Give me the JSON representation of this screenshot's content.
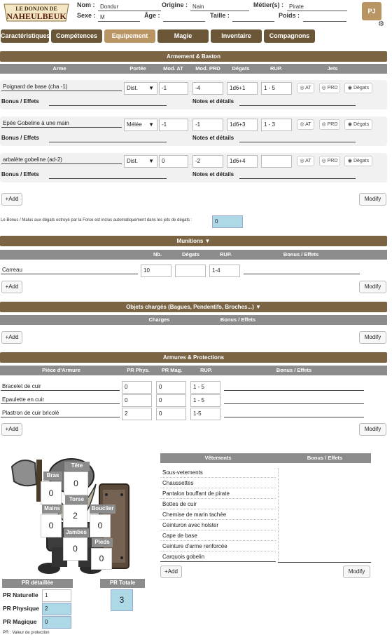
{
  "header": {
    "logo_text": "LE DONJON DE NAHEULBEUK",
    "nom_label": "Nom :",
    "nom": "Dondur",
    "origine_label": "Origine :",
    "origine": "Nain",
    "metier_label": "Métier(s) :",
    "metier": "Pirate",
    "sexe_label": "Sexe :",
    "sexe": "M",
    "age_label": "Âge :",
    "age": "",
    "taille_label": "Taille :",
    "taille": "",
    "poids_label": "Poids :",
    "poids": "",
    "pj_label": "PJ"
  },
  "tabs": [
    "Caractéristiques",
    "Compétences",
    "Equipement",
    "Magie",
    "Inventaire",
    "Compagnons"
  ],
  "armement": {
    "title": "Armement & Baston",
    "columns": [
      "Arme",
      "Portée",
      "Mod. AT",
      "Mod. PRD",
      "Dégats",
      "RUP.",
      "Jets"
    ],
    "bonus_label": "Bonus / Effets",
    "notes_label": "Notes et détails",
    "at_btn": "AT",
    "prd_btn": "PRD",
    "degats_btn": "Dégats",
    "weapons": [
      {
        "name": "Poignard de base (cha -1)",
        "portee": "Dist.",
        "at": "-1",
        "prd": "-4",
        "degats": "1d6+1",
        "rup": "1 - 5"
      },
      {
        "name": "Epée Gobeline à une main",
        "portee": "Mélée",
        "at": "-1",
        "prd": "-1",
        "degats": "1d6+3",
        "rup": "1 - 3"
      },
      {
        "name": "arbalète gobeline (ad-2)",
        "portee": "Dist.",
        "at": "0",
        "prd": "-2",
        "degats": "1d6+4",
        "rup": ""
      }
    ],
    "add": "+Add",
    "modify": "Modify",
    "force_note": "Le Bonus / Malus aux dégats octroyé par la Force est inclus automatiquement dans les jets de dégats :",
    "force_value": "0"
  },
  "munitions": {
    "title": "Munitions ▼",
    "columns": [
      "Nb.",
      "Dégats",
      "RUP.",
      "Bonus / Effets"
    ],
    "items": [
      {
        "name": "Carreau",
        "nb": "10",
        "degats": "",
        "rup": "1-4",
        "bonus": ""
      }
    ],
    "add": "+Add",
    "modify": "Modify"
  },
  "objets": {
    "title": "Objets chargés (Bagues, Pendentifs, Broches...) ▼",
    "columns": [
      "Charges",
      "Bonus / Effets"
    ],
    "add": "+Add",
    "modify": "Modify"
  },
  "armures": {
    "title": "Armures & Protections",
    "columns": [
      "Pièce d'Armure",
      "PR Phys.",
      "PR Mag.",
      "RUP.",
      "Bonus / Effets"
    ],
    "items": [
      {
        "name": "Bracelet de cuir",
        "phys": "0",
        "mag": "0",
        "rup": "1 - 5"
      },
      {
        "name": "Epaulette en cuir",
        "phys": "0",
        "mag": "0",
        "rup": "1 - 5"
      },
      {
        "name": "Plastron de cuir bricolé",
        "phys": "2",
        "mag": "0",
        "rup": "1-5"
      }
    ],
    "add": "+Add",
    "modify": "Modify"
  },
  "body": {
    "tete_label": "Tête",
    "tete": "0",
    "bras_label": "Bras",
    "bras": "0",
    "torse_label": "Torse",
    "torse": "2",
    "mains_label": "Mains",
    "mains": "0",
    "bouclier_label": "Bouclier",
    "bouclier": "0",
    "jambes_label": "Jambes",
    "jambes": "0",
    "pieds_label": "Pieds",
    "pieds": "0"
  },
  "vetements": {
    "columns": [
      "Vêtements",
      "Bonus / Effets"
    ],
    "items": [
      "Sous-vetements",
      "Chaussettes",
      "Pantalon bouffant de pirate",
      "Bottes de cuir",
      "Chemise de marin tachée",
      "Ceinturon avec holster",
      "Cape de base",
      "Ceinture d'arme renforcée",
      "Carquois gobelin"
    ],
    "add": "+Add",
    "modify": "Modify"
  },
  "pr": {
    "detail_title": "PR détaillée",
    "total_title": "PR Totale",
    "naturelle_label": "PR Naturelle",
    "naturelle": "1",
    "physique_label": "PR Physique",
    "physique": "2",
    "magique_label": "PR Magique",
    "magique": "0",
    "total": "3",
    "footnote": "PR : Valeur de protection"
  }
}
